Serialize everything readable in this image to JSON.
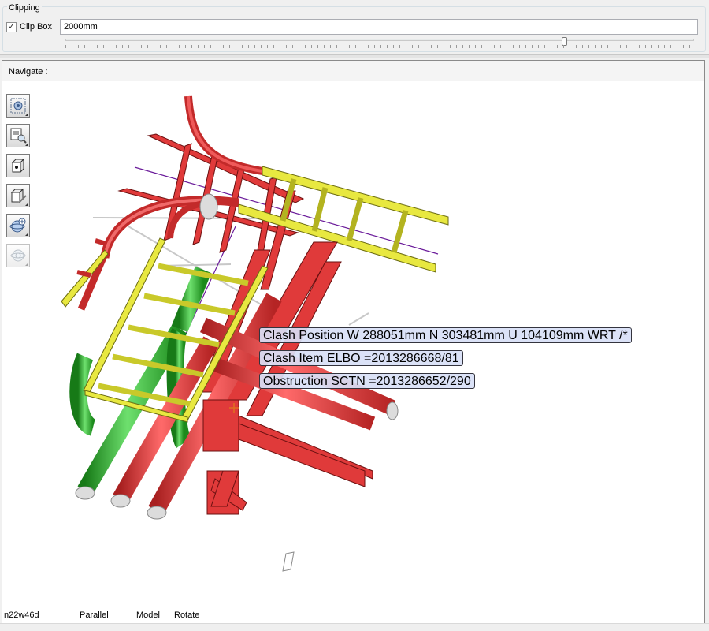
{
  "clipping": {
    "group_title": "Clipping",
    "clip_box_checked": true,
    "clip_box_label": "Clip Box",
    "clip_box_value": "2000mm",
    "slider_value_fraction": 0.79
  },
  "navigate": {
    "label": "Navigate :"
  },
  "toolbar": {
    "tools": [
      {
        "icon": "zoom-extents-icon"
      },
      {
        "icon": "zoom-to-selection-icon"
      },
      {
        "icon": "view-box-icon"
      },
      {
        "icon": "clip-volume-icon"
      },
      {
        "icon": "orbit-add-icon"
      },
      {
        "icon": "orbit-disabled-icon"
      }
    ]
  },
  "clash": {
    "position_text": "Clash Position W 288051mm N 303481mm U 104109mm WRT /*",
    "item_text": "Clash Item ELBO =2013286668/81",
    "obstruction_text": "Obstruction SCTN =2013286652/290"
  },
  "status_bar": {
    "view_name": "n22w46d",
    "projection": "Parallel",
    "mode": "Model",
    "action": "Rotate"
  },
  "colors": {
    "steel": "#e03a3a",
    "pipe_green": "#2fb12f",
    "ladder_yellow": "#dddd2c",
    "label_bg": "#d8e0f6"
  }
}
